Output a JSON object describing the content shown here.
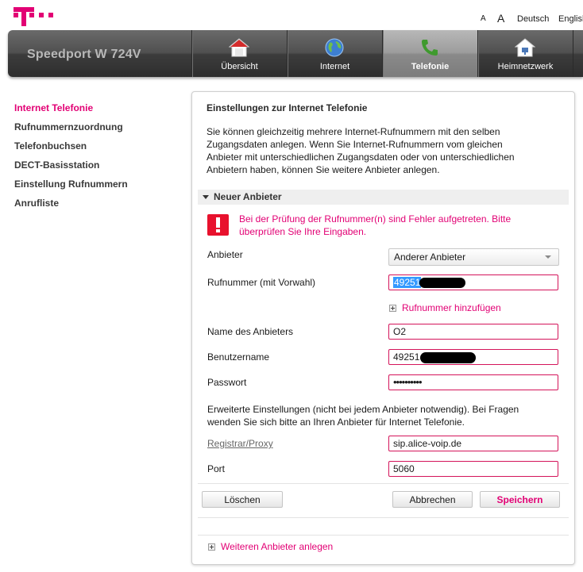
{
  "top": {
    "font_small": "A",
    "font_large": "A",
    "lang_de": "Deutsch",
    "lang_en": "English"
  },
  "header": {
    "product": "Speedport W 724V",
    "tabs": [
      {
        "label": "Übersicht",
        "icon": "home-icon"
      },
      {
        "label": "Internet",
        "icon": "globe-icon"
      },
      {
        "label": "Telefonie",
        "icon": "phone-icon",
        "active": true
      },
      {
        "label": "Heimnetzwerk",
        "icon": "network-icon"
      }
    ]
  },
  "sidebar": {
    "items": [
      {
        "label": "Internet Telefonie",
        "active": true
      },
      {
        "label": "Rufnummernzuordnung"
      },
      {
        "label": "Telefonbuchsen"
      },
      {
        "label": "DECT-Basisstation"
      },
      {
        "label": "Einstellung Rufnummern"
      },
      {
        "label": "Anrufliste"
      }
    ]
  },
  "panel": {
    "title": "Einstellungen zur Internet Telefonie",
    "description": "Sie können gleichzeitig mehrere Internet-Rufnummern mit den selben Zugangsdaten anlegen. Wenn Sie Internet-Rufnummern vom gleichen Anbieter mit unterschiedlichen Zugangsdaten oder von unterschiedlichen Anbietern haben, können Sie weitere Anbieter anlegen.",
    "section_title": "Neuer Anbieter",
    "error": "Bei der Prüfung der Rufnummer(n) sind Fehler aufgetreten. Bitte überprüfen Sie Ihre Eingaben.",
    "fields": {
      "anbieter_label": "Anbieter",
      "anbieter_value": "Anderer Anbieter",
      "rufnummer_label": "Rufnummer (mit Vorwahl)",
      "rufnummer_value": "49251",
      "add_number": "Rufnummer hinzufügen",
      "name_label": "Name des Anbieters",
      "name_value": "O2",
      "user_label": "Benutzername",
      "user_value": "49251",
      "pass_label": "Passwort",
      "pass_value": "••••••••••",
      "advanced_note": "Erweiterte Einstellungen (nicht bei jedem Anbieter notwendig). Bei Fragen wenden Sie sich bitte an Ihren Anbieter für Internet Telefonie.",
      "registrar_label": "Registrar/Proxy",
      "registrar_value": "sip.alice-voip.de",
      "port_label": "Port",
      "port_value": "5060"
    },
    "buttons": {
      "delete": "Löschen",
      "cancel": "Abbrechen",
      "save": "Speichern"
    },
    "add_provider": "Weiteren Anbieter anlegen"
  },
  "colors": {
    "brand": "#e20074",
    "error_icon": "#e8112d",
    "input_border": "#d4145a"
  }
}
